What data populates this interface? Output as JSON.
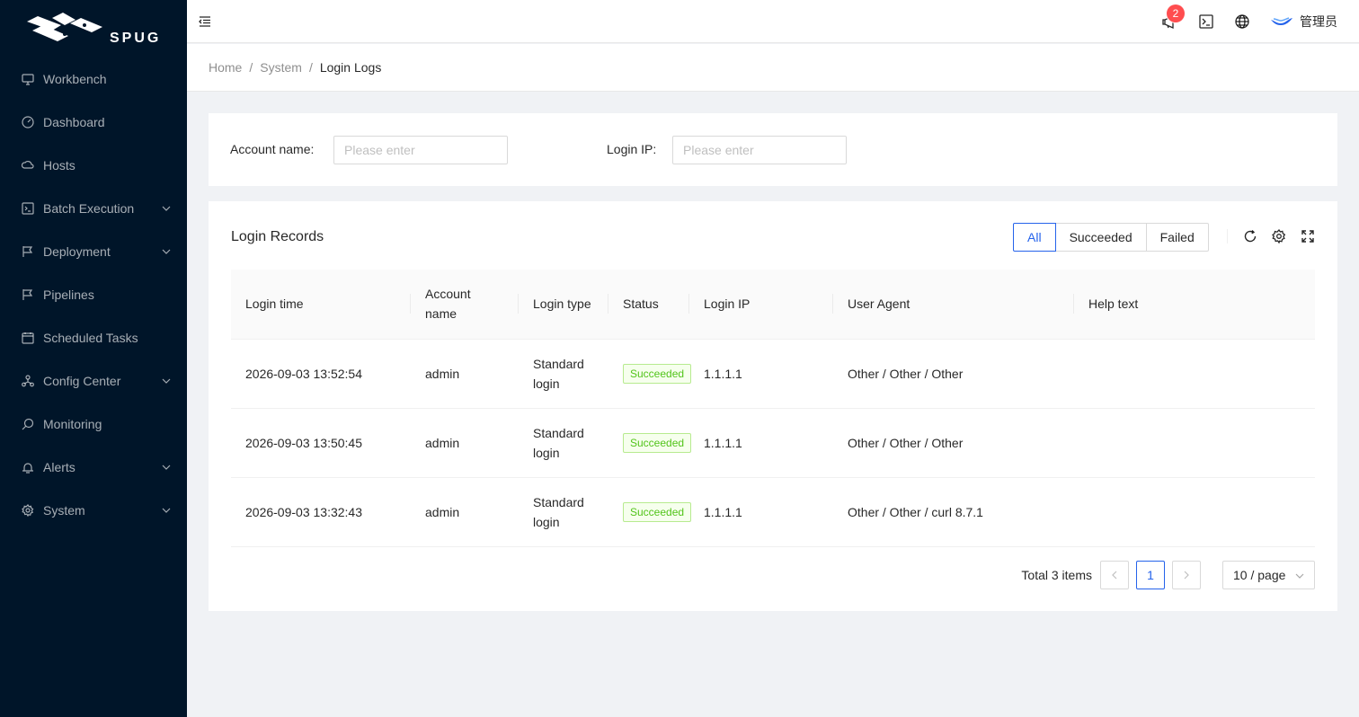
{
  "brand": {
    "name": "SPUG"
  },
  "sidebar": {
    "items": [
      {
        "label": "Workbench",
        "icon": "desktop-icon",
        "has_submenu": false
      },
      {
        "label": "Dashboard",
        "icon": "dashboard-icon",
        "has_submenu": false
      },
      {
        "label": "Hosts",
        "icon": "cloud-server-icon",
        "has_submenu": false
      },
      {
        "label": "Batch Execution",
        "icon": "code-icon",
        "has_submenu": true
      },
      {
        "label": "Deployment",
        "icon": "flag-icon",
        "has_submenu": true
      },
      {
        "label": "Pipelines",
        "icon": "pipeline-icon",
        "has_submenu": false
      },
      {
        "label": "Scheduled Tasks",
        "icon": "schedule-icon",
        "has_submenu": false
      },
      {
        "label": "Config Center",
        "icon": "deployment-unit-icon",
        "has_submenu": true
      },
      {
        "label": "Monitoring",
        "icon": "monitor-icon",
        "has_submenu": false
      },
      {
        "label": "Alerts",
        "icon": "alert-icon",
        "has_submenu": true
      },
      {
        "label": "System",
        "icon": "setting-icon",
        "has_submenu": true
      }
    ]
  },
  "header": {
    "notification_count": "2",
    "user_name": "管理员"
  },
  "breadcrumb": [
    "Home",
    "System",
    "Login Logs"
  ],
  "search": {
    "account_label": "Account name",
    "account_placeholder": "Please enter",
    "ip_label": "Login IP",
    "ip_placeholder": "Please enter"
  },
  "table_card": {
    "title": "Login Records",
    "filters": [
      "All",
      "Succeeded",
      "Failed"
    ],
    "active_filter": "All",
    "columns": [
      "Login time",
      "Account name",
      "Login type",
      "Status",
      "Login IP",
      "User Agent",
      "Help text"
    ],
    "rows": [
      {
        "time": "2026-09-03 13:52:54",
        "account": "admin",
        "type": "Standard login",
        "status": "Succeeded",
        "ip": "1.1.1.1",
        "agent": "Other / Other / Other",
        "help": ""
      },
      {
        "time": "2026-09-03 13:50:45",
        "account": "admin",
        "type": "Standard login",
        "status": "Succeeded",
        "ip": "1.1.1.1",
        "agent": "Other / Other / Other",
        "help": ""
      },
      {
        "time": "2026-09-03 13:32:43",
        "account": "admin",
        "type": "Standard login",
        "status": "Succeeded",
        "ip": "1.1.1.1",
        "agent": "Other / Other / curl 8.7.1",
        "help": ""
      }
    ]
  },
  "pagination": {
    "total_text": "Total 3 items",
    "current_page": "1",
    "page_size": "10 / page"
  },
  "colors": {
    "sidebar_bg": "#001529",
    "primary": "#2563eb",
    "success": "#52c41a",
    "badge": "#ff4d4f"
  }
}
